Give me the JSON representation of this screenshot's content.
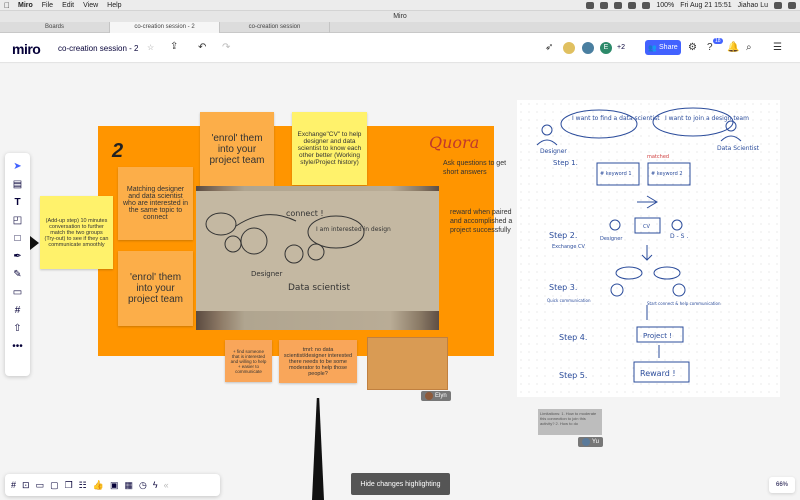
{
  "menubar": {
    "apple": "",
    "app_name": "Miro",
    "items": [
      "File",
      "Edit",
      "View",
      "Help"
    ],
    "battery": "100%",
    "datetime": "Fri Aug 21  15:51",
    "user": "Jiahao Lu"
  },
  "window": {
    "title": "Miro"
  },
  "tabs": [
    {
      "label": "Boards"
    },
    {
      "label": "co-creation session - 2"
    },
    {
      "label": "co-creation session"
    }
  ],
  "topbar": {
    "logo": "miro",
    "board_name": "co-creation session - 2",
    "collab_more": "+2",
    "share_label": "Share",
    "notif_count": "18",
    "avatar_e": "E"
  },
  "board": {
    "step_number": "2",
    "quora": "Quora",
    "ask_text": "Ask questions to get short answers",
    "reward_text": "reward when paired and accomplished a project successfully",
    "sticky_addup": "(Add-up step) 10 minutes conversation to further match the two groups  (Try-out) to see if they can communicate smoothly",
    "sticky_matching": "Matching designer and data scientist who are interested in the same topic to connect",
    "sticky_enrol1": "'enrol' them into your project team",
    "sticky_exchange": "Exchange\"CV\" to help designer and data scientist to know each other better (Working style/Project history)",
    "sticky_enrol2": "'enrol' them into your project team",
    "sticky_findsomeone": "+ find someone that is interested and willing to help + easier to communicate",
    "sticky_nodata": "tmrl: no data scientist/designer interested there needs to be some moderator to help those people?",
    "video_name": "Elyn",
    "grey_note": "Limitations: 1. How to moderate this connection to join this activity? 2. How to do",
    "grey_note_user": "Yu"
  },
  "sketch": {
    "bubble1": "I want to find a data scientist",
    "bubble2": "I want to join a design team",
    "designer": "Designer",
    "data_scientist": "Data Scientist",
    "step1": "Step 1.",
    "matched": "matched",
    "keyword1": "# keyword 1",
    "keyword2": "# keyword 2",
    "step2": "Step 2.",
    "exchange_cv": "Exchange CV",
    "cv": "CV",
    "designer2": "Designer",
    "ds2": "D - S .",
    "step3": "Step 3.",
    "quick_comm": "Quick communication",
    "start_comm": "Start connect & help communication",
    "step4": "Step 4.",
    "project": "Project !",
    "step5": "Step 5.",
    "reward": "Reward !"
  },
  "photo": {
    "ink_connect": "connect !",
    "ink_interested": "I am interested in design",
    "ink_designer": "Designer",
    "ink_ds": "Data scientist"
  },
  "bottom": {
    "hide_changes": "Hide changes highlighting",
    "zoom": "66%"
  },
  "icons": {
    "left_toolbar": [
      "cursor-icon",
      "template-icon",
      "text-icon",
      "sticky-note-icon",
      "shape-icon",
      "pen-icon",
      "pencil-icon",
      "comment-icon",
      "frame-icon",
      "upload-icon",
      "more-icon"
    ],
    "bottom_toolbar": [
      "frames-icon",
      "present-icon",
      "comments-icon",
      "screen-share-icon",
      "cards-icon",
      "vote-icon",
      "video-icon",
      "calendar-icon",
      "timer-icon",
      "activity-icon",
      "collapse-icon"
    ]
  },
  "colors": {
    "frame_orange": "#ff9500",
    "sticky_orange": "#fcae49",
    "sticky_yellow": "#fff26b",
    "share_blue": "#4262ff",
    "ink_blue": "#2b4c9b"
  }
}
